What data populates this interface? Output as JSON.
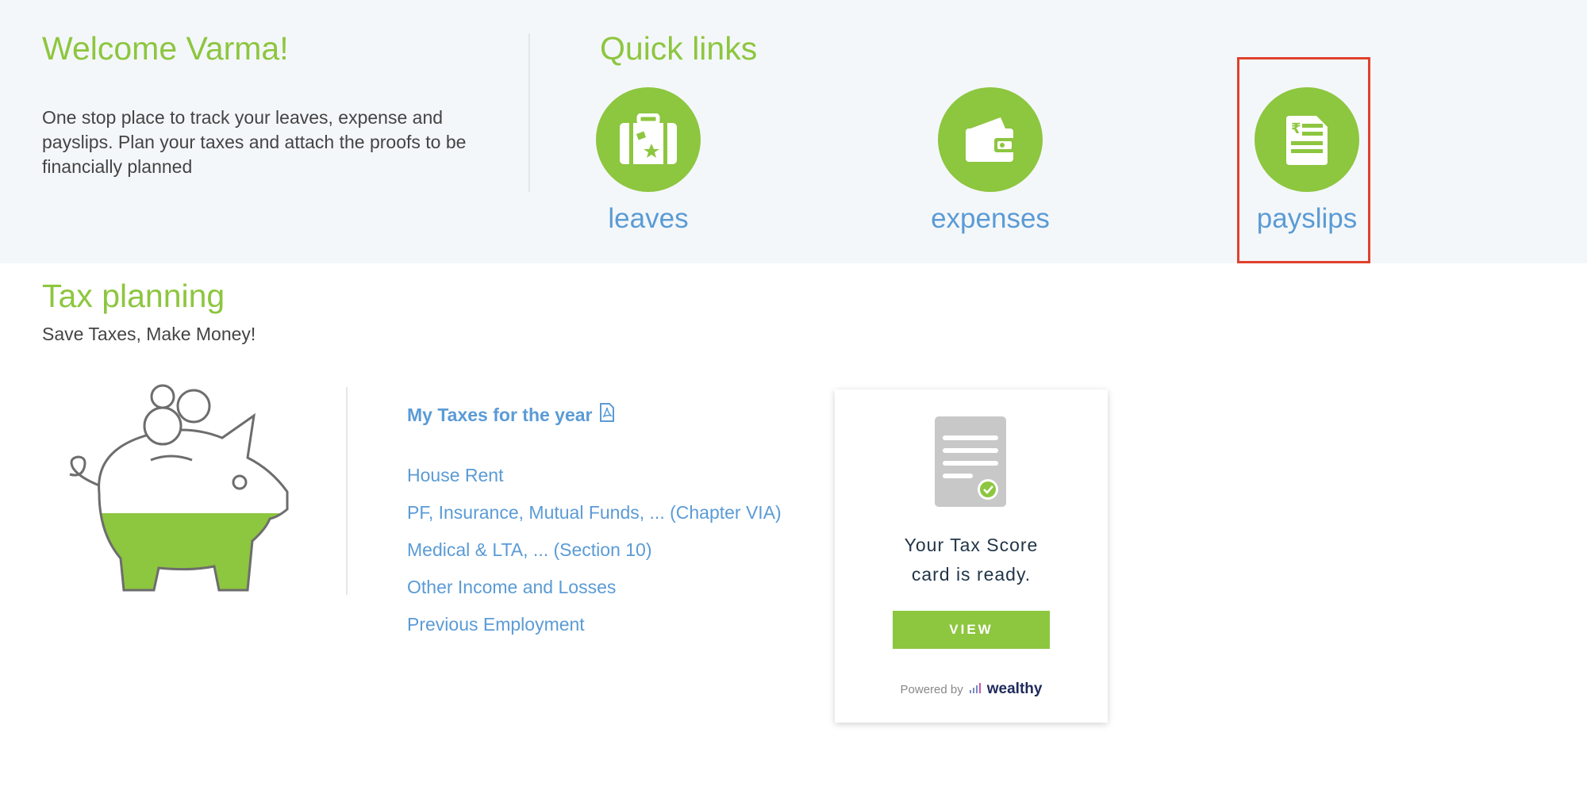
{
  "welcome": {
    "title": "Welcome Varma!",
    "description": "One stop place to track your leaves, expense and payslips. Plan your taxes and attach the proofs to be financially planned"
  },
  "quick_links": {
    "title": "Quick links",
    "items": [
      {
        "label": "leaves",
        "icon": "suitcase-icon"
      },
      {
        "label": "expenses",
        "icon": "wallet-icon"
      },
      {
        "label": "payslips",
        "icon": "payslip-document-icon"
      }
    ]
  },
  "tax_planning": {
    "title": "Tax planning",
    "subtitle": "Save Taxes, Make Money!",
    "my_taxes_label": "My Taxes for the year",
    "links": [
      "House Rent",
      "PF, Insurance, Mutual Funds, ... (Chapter VIA)",
      "Medical & LTA, ... (Section 10)",
      "Other Income and Losses",
      "Previous Employment"
    ]
  },
  "score_card": {
    "line1": "Your Tax Score",
    "line2": "card is ready.",
    "button": "VIEW",
    "powered_by": "Powered by",
    "brand": "wealthy"
  },
  "colors": {
    "accent_green": "#8dc63f",
    "link_blue": "#5b9bd5",
    "highlight_red": "#e0412c"
  }
}
